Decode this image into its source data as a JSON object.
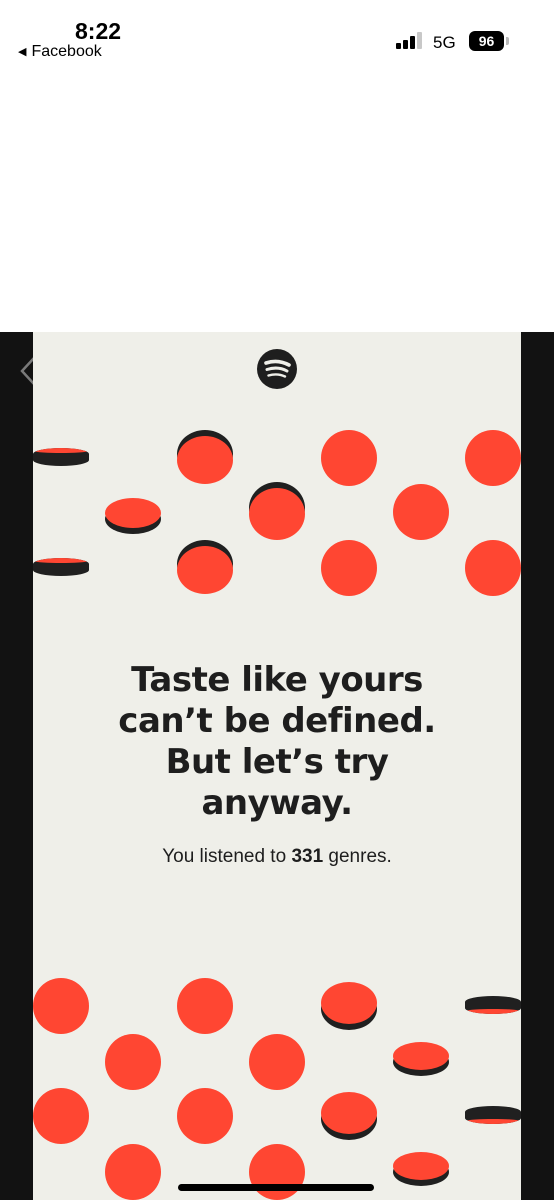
{
  "status": {
    "time": "8:22",
    "back_app": "Facebook",
    "network": "5G",
    "battery": "96"
  },
  "story": {
    "headline_lines": [
      "Taste like yours",
      "can’t be defined.",
      "But let’s try",
      "anyway."
    ],
    "sub_prefix": "You listened to ",
    "genre_count": "331",
    "sub_suffix": " genres."
  },
  "icons": {
    "back": "chevron-left-icon",
    "logo": "spotify-logo-icon",
    "sound": "speaker-icon"
  },
  "colors": {
    "accent": "#ff4632",
    "panel": "#efefe9",
    "dark": "#202020",
    "frame": "#121212"
  }
}
